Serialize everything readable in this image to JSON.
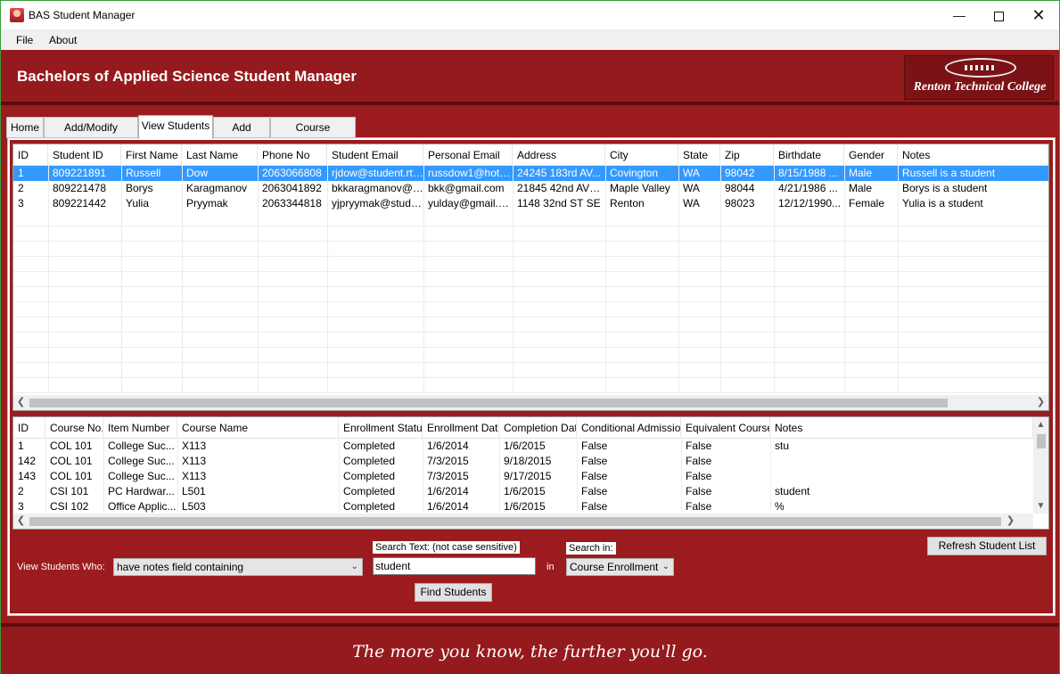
{
  "window": {
    "title": "BAS Student Manager"
  },
  "menu": {
    "file": "File",
    "about": "About"
  },
  "banner": {
    "heading": "Bachelors of Applied Science Student Manager",
    "logo_text": "Renton Technical College"
  },
  "tabs": [
    {
      "label": "Home"
    },
    {
      "label": "Add/Modify Student"
    },
    {
      "label": "View Students",
      "active": true
    },
    {
      "label": "Add Course"
    },
    {
      "label": "Course Enrollment"
    }
  ],
  "students_grid": {
    "columns": [
      "ID",
      "Student ID",
      "First Name",
      "Last Name",
      "Phone No",
      "Student Email",
      "Personal Email",
      "Address",
      "City",
      "State",
      "Zip",
      "Birthdate",
      "Gender",
      "Notes"
    ],
    "rows": [
      [
        "1",
        "809221891",
        "Russell",
        "Dow",
        "2063066808",
        "rjdow@student.rtc....",
        "russdow1@hotm...",
        "24245 183rd AV...",
        "Covington",
        "WA",
        "98042",
        "8/15/1988 ...",
        "Male",
        "Russell is a student"
      ],
      [
        "2",
        "809221478",
        "Borys",
        "Karagmanov",
        "2063041892",
        "bkkaragmanov@s...",
        "bkk@gmail.com",
        "21845 42nd AVE S",
        "Maple Valley",
        "WA",
        "98044",
        "4/21/1986 ...",
        "Male",
        "Borys is a student"
      ],
      [
        "3",
        "809221442",
        "Yulia",
        "Pryymak",
        "2063344818",
        "yjpryymak@stude...",
        "yulday@gmail.com",
        "1148 32nd ST SE",
        "Renton",
        "WA",
        "98023",
        "12/12/1990...",
        "Female",
        "Yulia is a student"
      ]
    ],
    "selected_row": 0
  },
  "enrollment_grid": {
    "columns": [
      "ID",
      "Course No.",
      "Item Number",
      "Course Name",
      "Enrollment Status",
      "Enrollment Date",
      "Completion Date",
      "Conditional Admission",
      "Equivalent Course",
      "Notes"
    ],
    "rows": [
      [
        "1",
        "COL 101",
        "College Suc...",
        "X113",
        "Completed",
        "1/6/2014",
        "1/6/2015",
        "False",
        "False",
        "stu"
      ],
      [
        "142",
        "COL 101",
        "College Suc...",
        "X113",
        "Completed",
        "7/3/2015",
        "9/18/2015",
        "False",
        "False",
        ""
      ],
      [
        "143",
        "COL 101",
        "College Suc...",
        "X113",
        "Completed",
        "7/3/2015",
        "9/17/2015",
        "False",
        "False",
        ""
      ],
      [
        "2",
        "CSI 101",
        "PC Hardwar...",
        "L501",
        "Completed",
        "1/6/2014",
        "1/6/2015",
        "False",
        "False",
        "student"
      ],
      [
        "3",
        "CSI 102",
        "Office Applic...",
        "L503",
        "Completed",
        "1/6/2014",
        "1/6/2015",
        "False",
        "False",
        "%"
      ]
    ]
  },
  "search": {
    "view_label": "View Students Who:",
    "filter_value": "have notes field containing",
    "search_text_label": "Search Text: (not case sensitive)",
    "search_text_value": "student",
    "in_label": "in",
    "search_in_label": "Search in:",
    "search_in_value": "Course Enrollment",
    "find_button": "Find Students",
    "refresh_button": "Refresh Student List"
  },
  "footer": {
    "tagline": "The more you know, the further you'll go."
  }
}
